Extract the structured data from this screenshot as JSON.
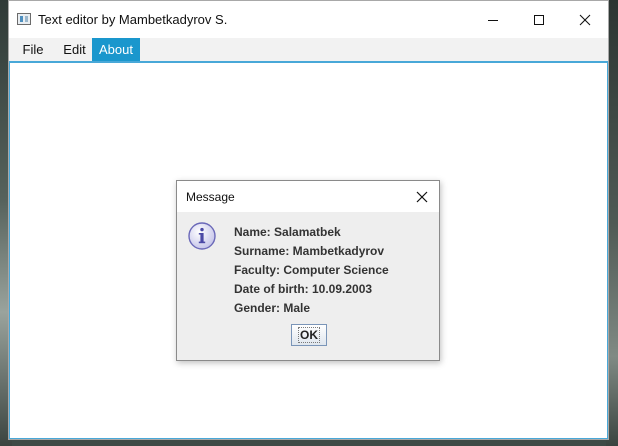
{
  "window": {
    "title": "Text editor by Mambetkadyrov S."
  },
  "menu": {
    "items": [
      {
        "label": "File"
      },
      {
        "label": "Edit"
      },
      {
        "label": "About",
        "active": true
      }
    ]
  },
  "dialog": {
    "title": "Message",
    "icon": "info-icon",
    "lines": [
      "Name: Salamatbek",
      "Surname: Mambetkadyrov",
      "Faculty: Computer Science",
      "Date of birth: 10.09.2003",
      "Gender: Male"
    ],
    "ok_label": "OK"
  },
  "colors": {
    "accent": "#1a97cd",
    "content_border": "#48a8d8",
    "dialog_bg": "#eeeeee"
  }
}
